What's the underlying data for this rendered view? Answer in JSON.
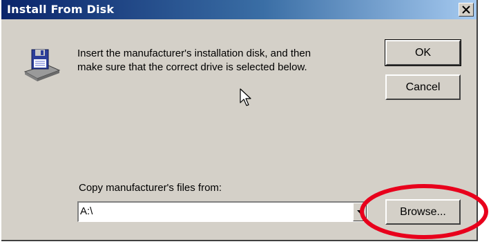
{
  "dialog": {
    "title": "Install From Disk",
    "message_line1": "Insert the manufacturer's installation disk, and then",
    "message_line2": "make sure that the correct drive is selected below.",
    "copy_from_label": "Copy manufacturer's files from:",
    "path_value": "A:\\",
    "ok_label": "OK",
    "cancel_label": "Cancel",
    "browse_label": "Browse..."
  },
  "icons": {
    "disk": "floppy-disk-icon",
    "close": "close-icon",
    "dropdown": "chevron-down-icon",
    "cursor": "mouse-pointer-icon"
  },
  "colors": {
    "title_bar_start": "#0a246a",
    "title_bar_end": "#a6caf0",
    "dialog_face": "#d4d0c8",
    "highlight_annotation": "#e8001c"
  }
}
